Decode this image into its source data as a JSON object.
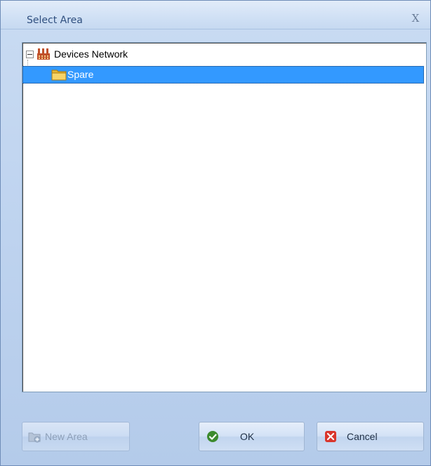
{
  "window": {
    "title": "Select Area",
    "close_glyph": "X"
  },
  "tree": {
    "root": {
      "label": "Devices Network",
      "icon": "factory-icon",
      "expanded": true
    },
    "children": [
      {
        "label": "Spare",
        "icon": "folder-icon",
        "selected": true
      }
    ]
  },
  "buttons": {
    "new_area": {
      "label": "New Area",
      "icon": "new-folder-icon",
      "enabled": false
    },
    "ok": {
      "label": "OK",
      "icon": "check-icon"
    },
    "cancel": {
      "label": "Cancel",
      "icon": "cancel-x-icon"
    }
  },
  "colors": {
    "selection": "#3399ff",
    "title_text": "#2f4f7f",
    "dialog_bg": "#bed3ef",
    "ok_icon": "#3c8a2e",
    "cancel_icon": "#d9362c",
    "factory_icon": "#c0502a",
    "folder_icon": "#f2c84b"
  }
}
